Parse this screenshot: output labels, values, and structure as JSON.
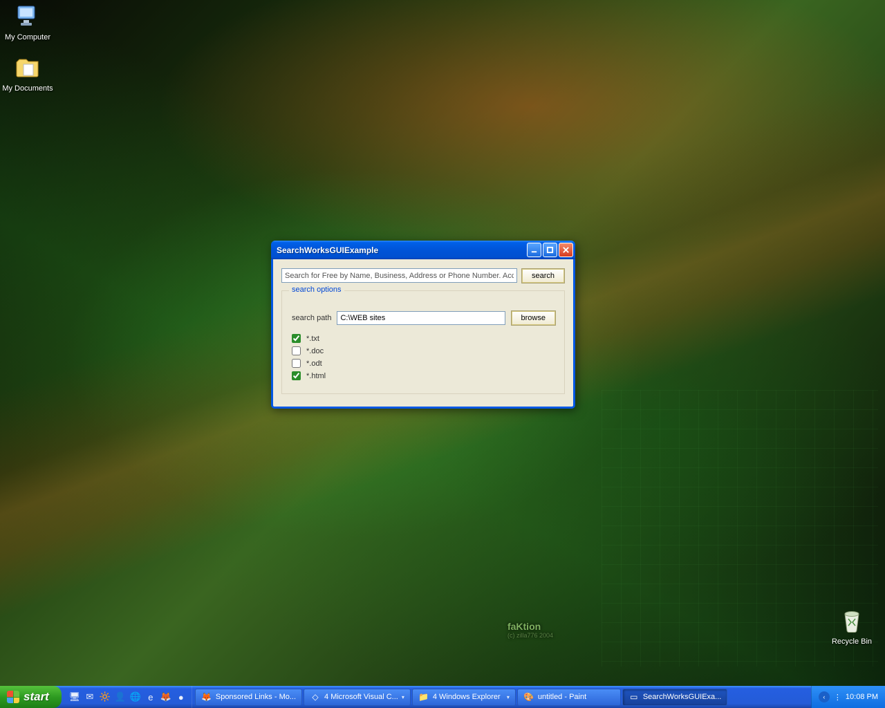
{
  "desktop": {
    "icons": {
      "my_computer": "My Computer",
      "my_documents": "My Documents",
      "recycle_bin": "Recycle Bin"
    },
    "wallpaper_credit": {
      "name": "faKtion",
      "sub": "(c) zilla776 2004"
    }
  },
  "window": {
    "title": "SearchWorksGUIExample",
    "search_input_value": "Search for Free by Name, Business, Address or Phone Number. Accurate",
    "search_button": "search",
    "options": {
      "legend": "search options",
      "path_label": "search path",
      "path_value": "C:\\WEB sites",
      "browse_button": "browse",
      "filetypes": [
        {
          "label": "*.txt",
          "checked": true
        },
        {
          "label": "*.doc",
          "checked": false
        },
        {
          "label": "*.odt",
          "checked": false
        },
        {
          "label": "*.html",
          "checked": true
        }
      ]
    }
  },
  "taskbar": {
    "start": "start",
    "items": [
      {
        "label": "Sponsored Links - Mo...",
        "icon": "🦊",
        "has_dropdown": false,
        "active": false
      },
      {
        "label": "4 Microsoft Visual C...",
        "icon": "◇",
        "has_dropdown": true,
        "active": false
      },
      {
        "label": "4 Windows Explorer",
        "icon": "📁",
        "has_dropdown": true,
        "active": false
      },
      {
        "label": "untitled - Paint",
        "icon": "🎨",
        "has_dropdown": false,
        "active": false
      },
      {
        "label": "SearchWorksGUIExa...",
        "icon": "▭",
        "has_dropdown": false,
        "active": true
      }
    ],
    "clock": "10:08 PM"
  }
}
